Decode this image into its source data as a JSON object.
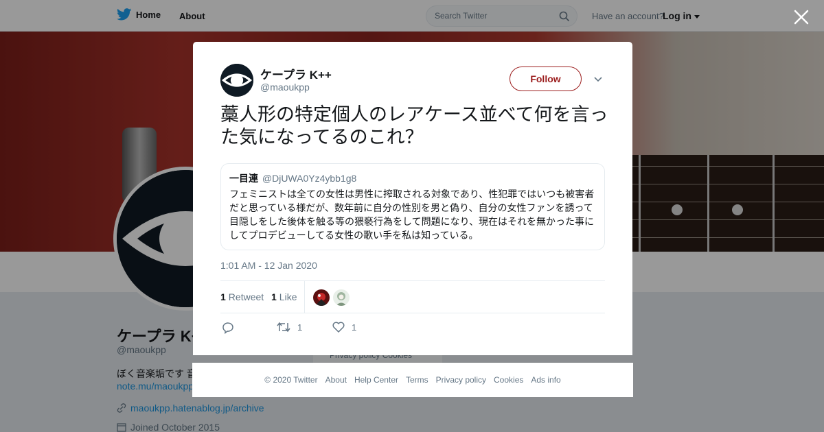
{
  "topbar": {
    "home_label": "Home",
    "about_label": "About",
    "search_placeholder": "Search Twitter",
    "account_prompt": "Have an account?",
    "login_label": "Log in"
  },
  "profile": {
    "name": "ケープラ K++",
    "handle": "@maoukpp",
    "bio": "ぼく音楽垢です 音",
    "note_link": "note.mu/maoukpp",
    "website": "maoukpp.hatenablog.jp/archive",
    "joined": "Joined October 2015",
    "privacy_bits": "Privacy policy   Cookies"
  },
  "tweet": {
    "author_name": "ケープラ K++",
    "author_handle": "@maoukpp",
    "follow_label": "Follow",
    "text": "藁人形の特定個人のレアケース並べて何を言った気になってるのこれ？",
    "quote": {
      "name": "一目連",
      "handle": "@DjUWA0Yz4ybb1g8",
      "text": "フェミニストは全ての女性は男性に搾取される対象であり、性犯罪ではいつも被害者だと思っている様だが、数年前に自分の性別を男と偽り、自分の女性ファンを誘って目隠しをした後体を触る等の猥褻行為をして問題になり、現在はそれを無かった事にしてプロデビューしてる女性の歌い手を私は知っている。"
    },
    "timestamp": "1:01 AM - 12 Jan 2020",
    "retweet_count": "1",
    "retweet_label": "Retweet",
    "like_count": "1",
    "like_label": "Like",
    "action_retweet_count": "1",
    "action_like_count": "1"
  },
  "footer": {
    "items": [
      "© 2020 Twitter",
      "About",
      "Help Center",
      "Terms",
      "Privacy policy",
      "Cookies",
      "Ads info"
    ]
  },
  "colors": {
    "brand_blue": "#1da1f2",
    "follow_accent": "#9b1c1c",
    "overlay": "rgba(0,0,0,0.4)"
  },
  "icons": [
    "twitter-bird-icon",
    "search-icon",
    "caret-down-icon",
    "close-icon",
    "reply-icon",
    "retweet-icon",
    "heart-icon",
    "link-icon",
    "calendar-icon"
  ]
}
